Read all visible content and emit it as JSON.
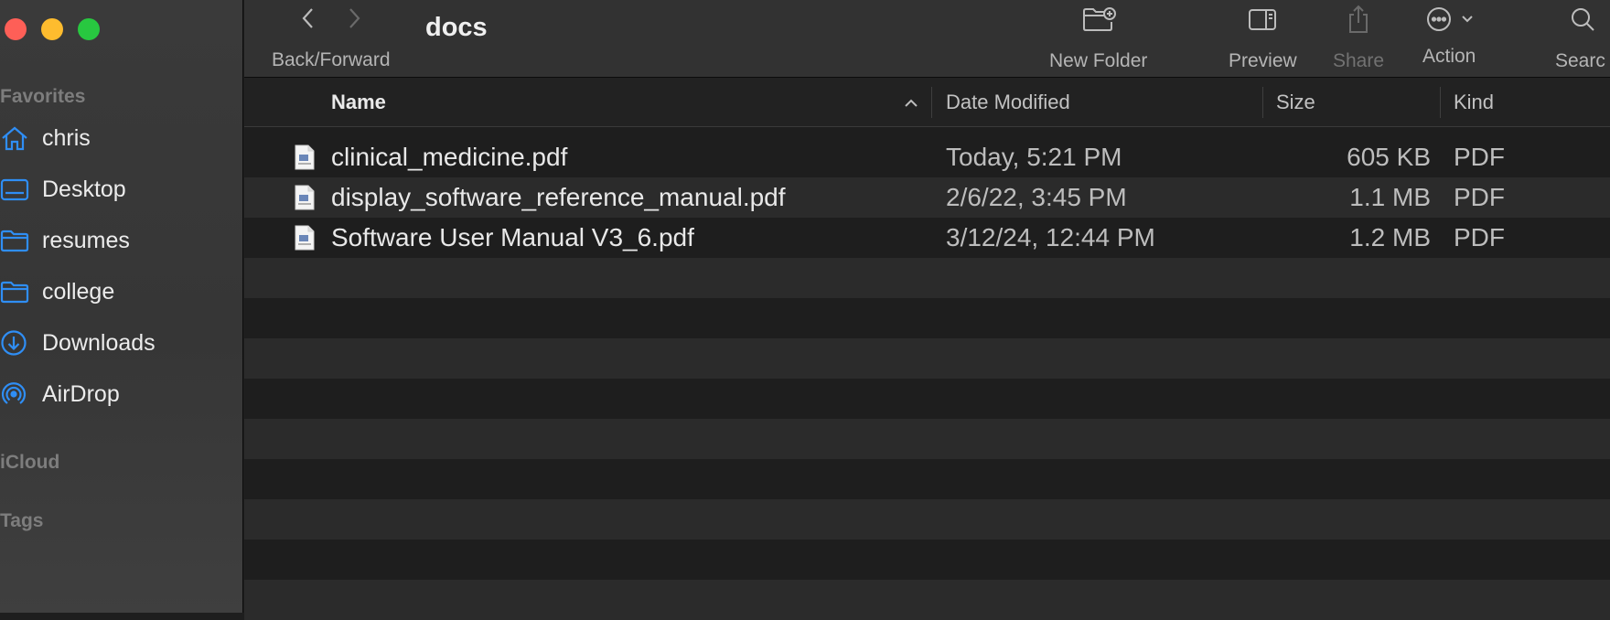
{
  "window": {
    "title": "docs"
  },
  "toolbar": {
    "back_forward_label": "Back/Forward",
    "new_folder_label": "New Folder",
    "preview_label": "Preview",
    "share_label": "Share",
    "action_label": "Action",
    "search_label": "Searc"
  },
  "sidebar": {
    "favorites_header": "Favorites",
    "icloud_header": "iCloud",
    "tags_header": "Tags",
    "items": [
      {
        "label": "chris",
        "icon": "home-icon"
      },
      {
        "label": "Desktop",
        "icon": "desktop-icon"
      },
      {
        "label": "resumes",
        "icon": "folder-icon"
      },
      {
        "label": "college",
        "icon": "folder-icon"
      },
      {
        "label": "Downloads",
        "icon": "downloads-icon"
      },
      {
        "label": "AirDrop",
        "icon": "airdrop-icon"
      }
    ]
  },
  "columns": {
    "name": "Name",
    "date": "Date Modified",
    "size": "Size",
    "kind": "Kind",
    "sort": "ascending"
  },
  "files": [
    {
      "name": "clinical_medicine.pdf",
      "date": "Today, 5:21 PM",
      "size": "605 KB",
      "kind": "PDF"
    },
    {
      "name": "display_software_reference_manual.pdf",
      "date": "2/6/22, 3:45 PM",
      "size": "1.1 MB",
      "kind": "PDF"
    },
    {
      "name": "Software User Manual V3_6.pdf",
      "date": "3/12/24, 12:44 PM",
      "size": "1.2 MB",
      "kind": "PDF"
    }
  ],
  "colors": {
    "accent": "#2f8ef5",
    "close": "#fe5f57",
    "minimize": "#febc2e",
    "zoom": "#28c840"
  }
}
